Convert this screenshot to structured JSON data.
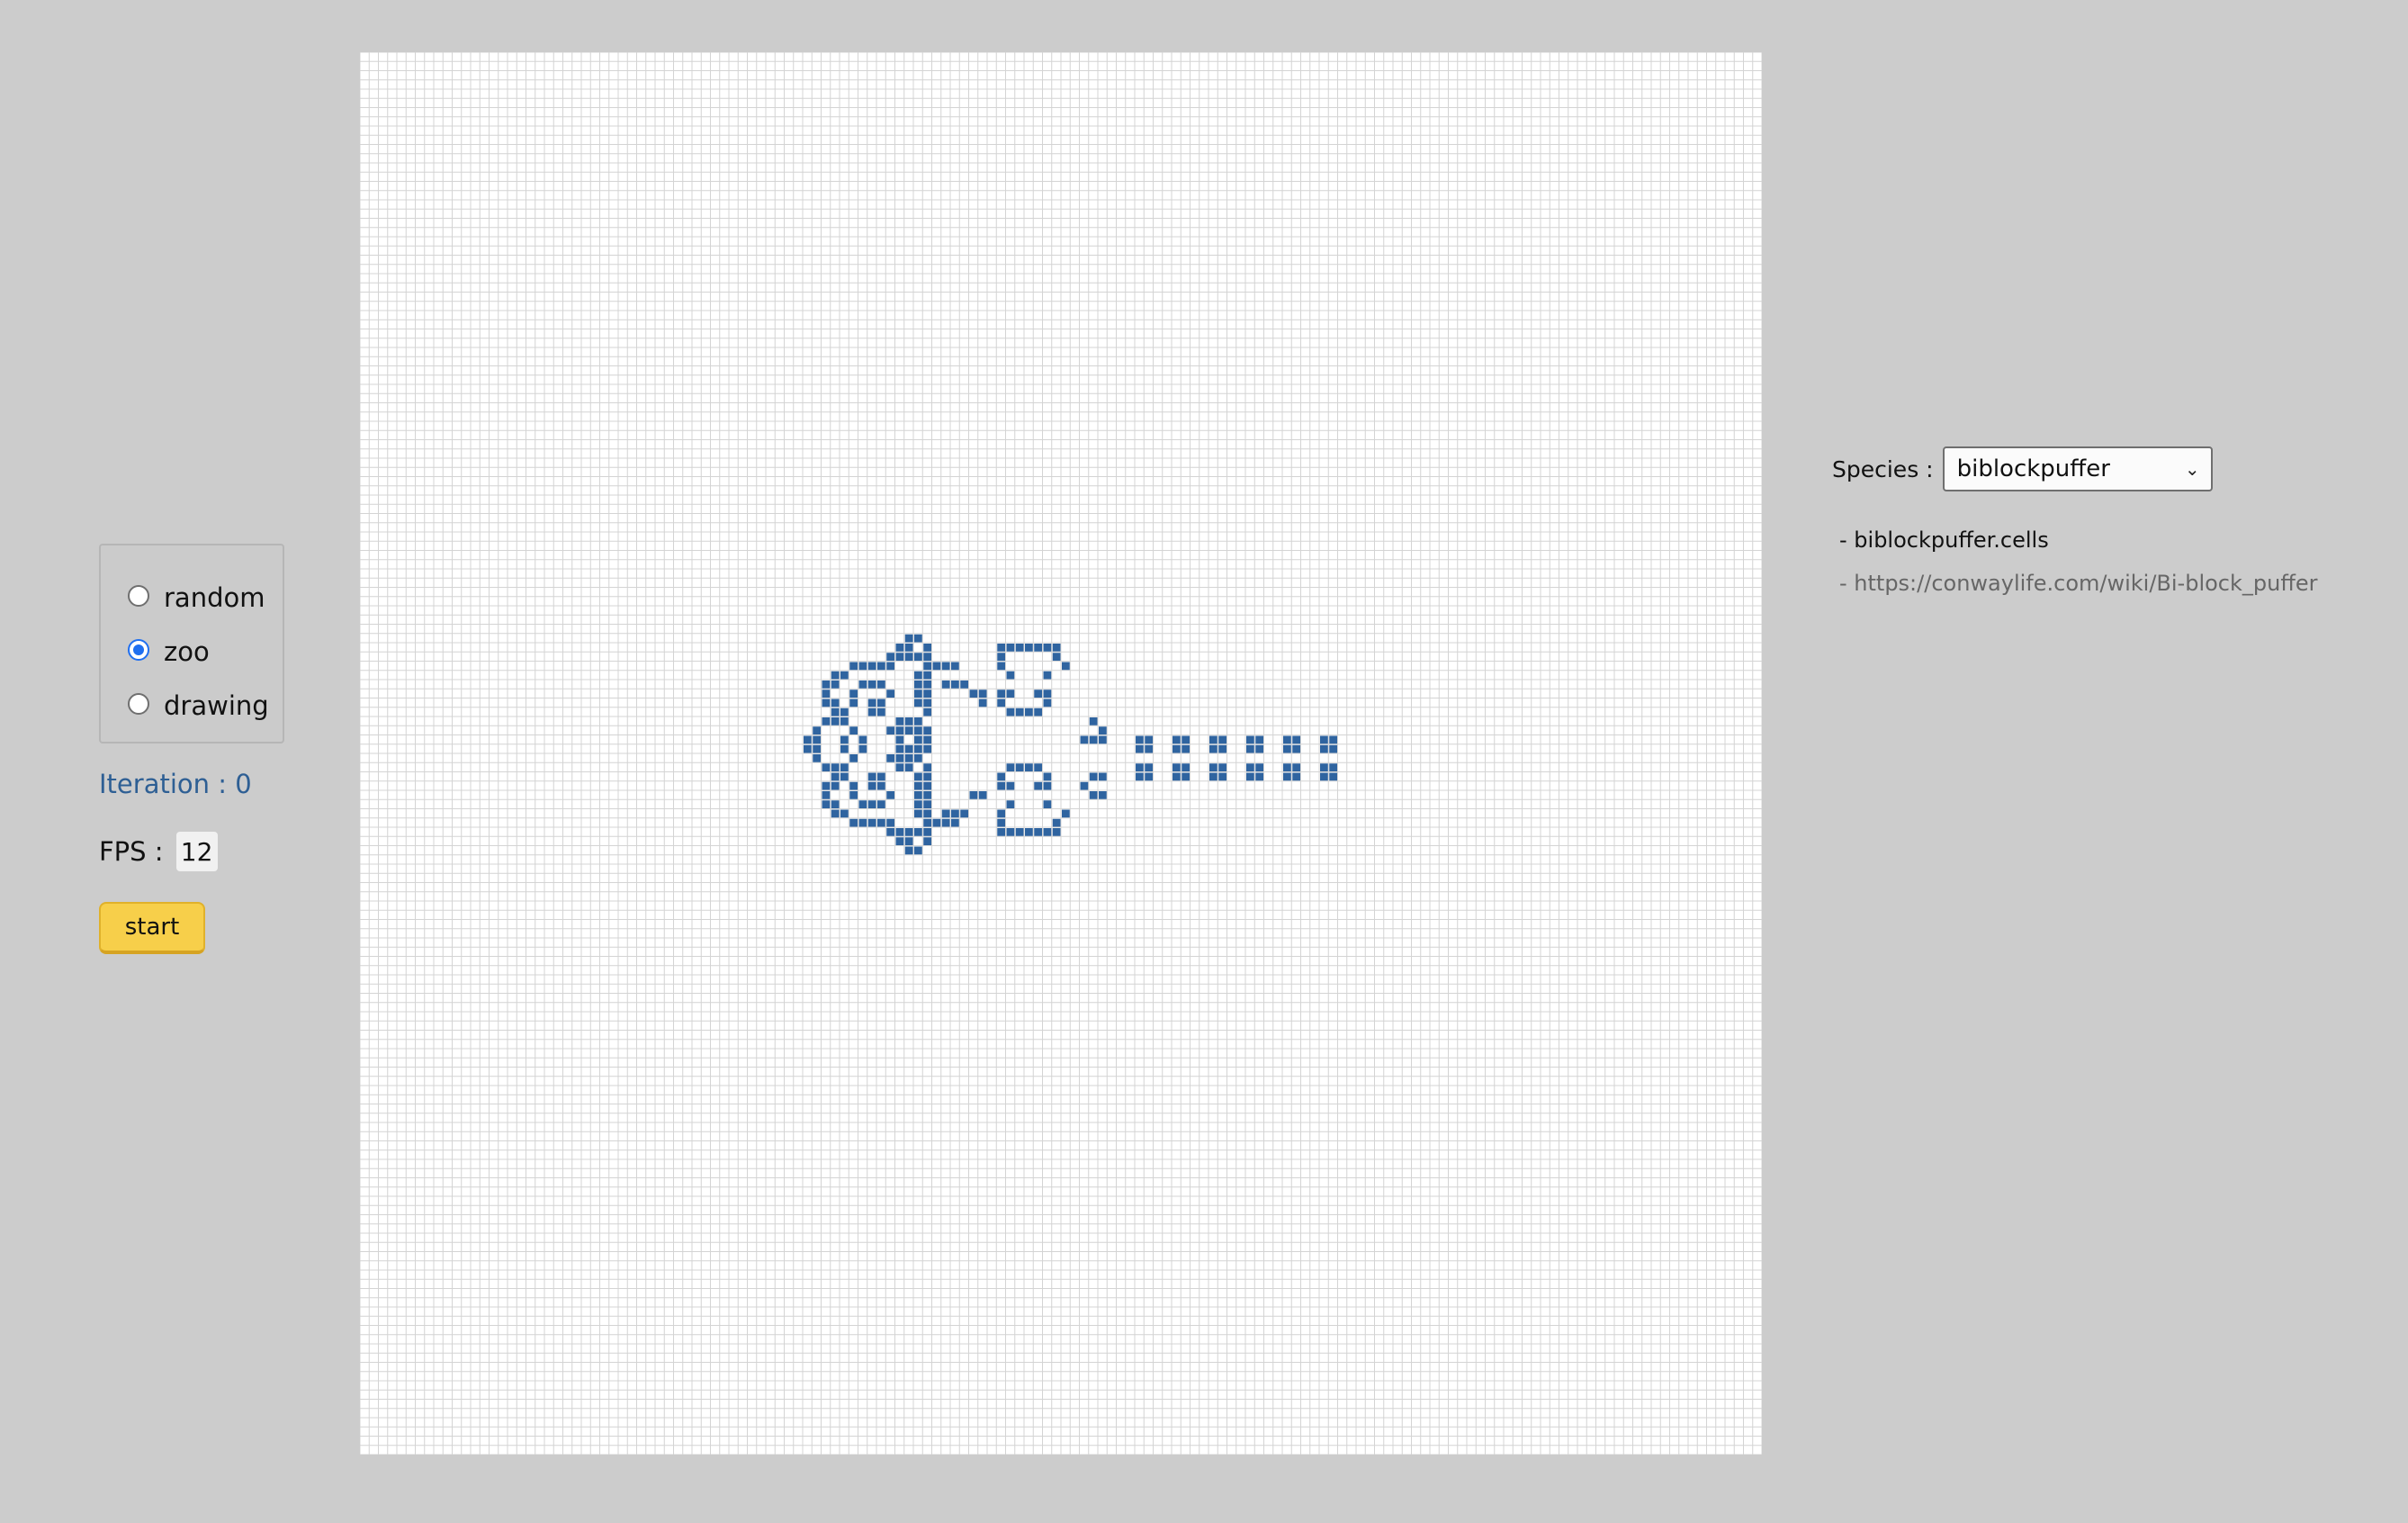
{
  "modes": [
    {
      "label": "random",
      "checked": false
    },
    {
      "label": "zoo",
      "checked": true
    },
    {
      "label": "drawing",
      "checked": false
    }
  ],
  "iteration_text": "Iteration : 0",
  "fps": {
    "label": "FPS :",
    "value": "12"
  },
  "start_label": "start",
  "species": {
    "label": "Species :",
    "selected": "biblockpuffer",
    "file": "- biblockpuffer.cells",
    "url": "- https://conwaylife.com/wiki/Bi-block_puffer"
  },
  "grid": {
    "cols": 152,
    "rows": 152
  },
  "colors": {
    "background": "#cccccc",
    "live_cell": "#2f64a0",
    "grid_line": "#d4d4d4",
    "accent": "#f7cf4a"
  }
}
